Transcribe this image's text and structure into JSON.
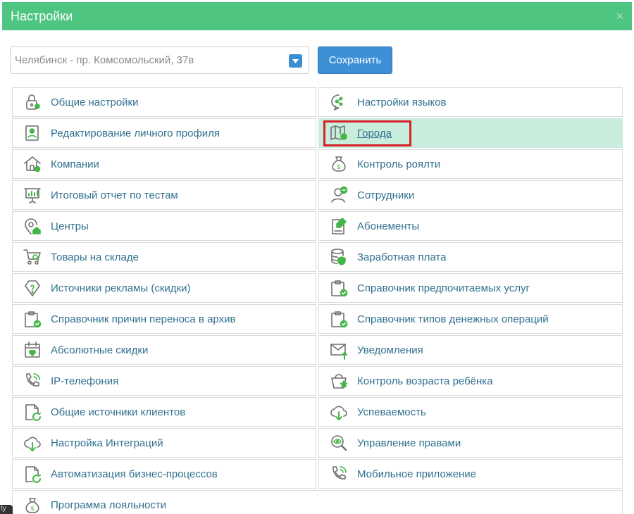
{
  "modal": {
    "title": "Настройки",
    "close_symbol": "×"
  },
  "toolbar": {
    "location_value": "Челябинск - пр. Комсомольский, 37в",
    "save_label": "Сохранить"
  },
  "colors": {
    "header": "#4ec581",
    "icon_gray": "#6f6f6f",
    "icon_green": "#44b649",
    "link": "#31708f",
    "active_bg": "#c9eddc",
    "highlight": "#d61f26",
    "button": "#3d8fd6"
  },
  "items": [
    {
      "label": "Общие настройки",
      "icon": "lock-key-icon"
    },
    {
      "label": "Настройки языков",
      "icon": "chat-share-icon"
    },
    {
      "label": "Редактирование личного профиля",
      "icon": "profile-card-icon"
    },
    {
      "label": "Города",
      "icon": "map-pin-icon",
      "active": true
    },
    {
      "label": "Компании",
      "icon": "house-icon"
    },
    {
      "label": "Контроль роялти",
      "icon": "money-bag-icon"
    },
    {
      "label": "Итоговый отчет по тестам",
      "icon": "presentation-chart-icon"
    },
    {
      "label": "Сотрудники",
      "icon": "employee-icon"
    },
    {
      "label": "Центры",
      "icon": "location-home-icon"
    },
    {
      "label": "Абонементы",
      "icon": "document-edit-icon"
    },
    {
      "label": "Товары на складе",
      "icon": "cart-search-icon"
    },
    {
      "label": "Заработная плата",
      "icon": "database-shield-icon"
    },
    {
      "label": "Источники рекламы (скидки)",
      "icon": "question-tag-icon"
    },
    {
      "label": "Справочник предпочитаемых услуг",
      "icon": "clipboard-check-icon"
    },
    {
      "label": "Справочник причин переноса в архив",
      "icon": "clipboard-check-icon"
    },
    {
      "label": "Справочник типов денежных операций",
      "icon": "clipboard-check-icon"
    },
    {
      "label": "Абсолютные скидки",
      "icon": "calendar-heart-icon"
    },
    {
      "label": "Уведомления",
      "icon": "envelope-arrow-icon"
    },
    {
      "label": "IP-телефония",
      "icon": "phone-signal-icon"
    },
    {
      "label": "Контроль возраста ребёнка",
      "icon": "basket-star-icon"
    },
    {
      "label": "Общие источники клиентов",
      "icon": "file-refresh-icon"
    },
    {
      "label": "Успеваемость",
      "icon": "cloud-download-icon"
    },
    {
      "label": "Настройка Интеграций",
      "icon": "cloud-download-icon"
    },
    {
      "label": "Управление правами",
      "icon": "eye-search-icon"
    },
    {
      "label": "Автоматизация бизнес-процессов",
      "icon": "file-refresh-icon"
    },
    {
      "label": "Мобильное приложение",
      "icon": "phone-signal-icon"
    },
    {
      "label": "Программа лояльности",
      "icon": "money-bag-icon"
    }
  ],
  "corner_tab_text": "ty"
}
